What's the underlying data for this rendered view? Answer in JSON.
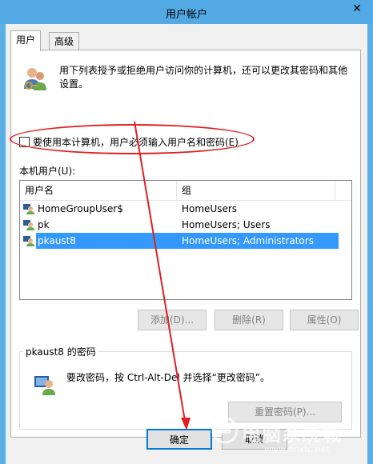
{
  "window": {
    "title": "用户帐户"
  },
  "tabs": [
    {
      "label": "用户"
    },
    {
      "label": "高级"
    }
  ],
  "intro": {
    "text": "用下列表授予或拒绝用户访问你的计算机，还可以更改其密码和其他设置。"
  },
  "checkbox": {
    "label": "要使用本计算机，用户必须输入用户名和密码(E)",
    "checked": false
  },
  "users_section": {
    "label": "本机用户(U):",
    "columns": [
      "用户名",
      "组"
    ],
    "rows": [
      {
        "name": "HomeGroupUser$",
        "group": "HomeUsers"
      },
      {
        "name": "pk",
        "group": "HomeUsers; Users"
      },
      {
        "name": "pkaust8",
        "group": "HomeUsers; Administrators"
      }
    ],
    "selected_index": 2
  },
  "actions": {
    "add": "添加(D)...",
    "remove": "删除(R)",
    "properties": "属性(O)"
  },
  "password_group": {
    "legend": "pkaust8 的密码",
    "text": "要改密码，按 Ctrl-Alt-Del 并选择“更改密码”。",
    "reset_button": "重置密码(P)..."
  },
  "footer": {
    "ok": "确定",
    "cancel": "取消"
  },
  "watermark": {
    "text": "电脑系统城",
    "url": "www.dnxtc.net"
  },
  "colors": {
    "titlebar": "#52a9e3",
    "selection": "#3399ff",
    "annotation": "#e02020"
  }
}
